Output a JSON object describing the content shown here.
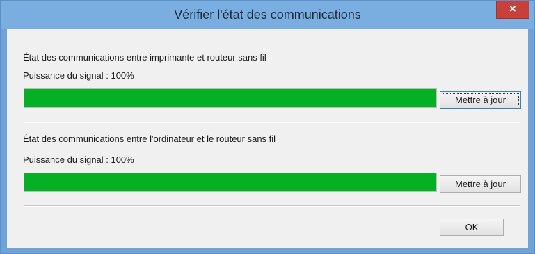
{
  "window": {
    "title": "Vérifier l'état des communications",
    "close_label": "×"
  },
  "printer_router": {
    "heading": "État des communications entre imprimante et routeur sans fil",
    "signal_text": "Puissance du signal : 100%",
    "signal_value": 100,
    "update_label": "Mettre à jour"
  },
  "computer_router": {
    "heading": "État des communications entre l'ordinateur et le routeur sans fil",
    "signal_text": "Puissance du signal : 100%",
    "signal_value": 100,
    "update_label": "Mettre à jour"
  },
  "footer": {
    "ok_label": "OK"
  },
  "colors": {
    "progress_fill": "#06b025",
    "close_button": "#c7413a",
    "title_bar": "#7aaee0"
  }
}
